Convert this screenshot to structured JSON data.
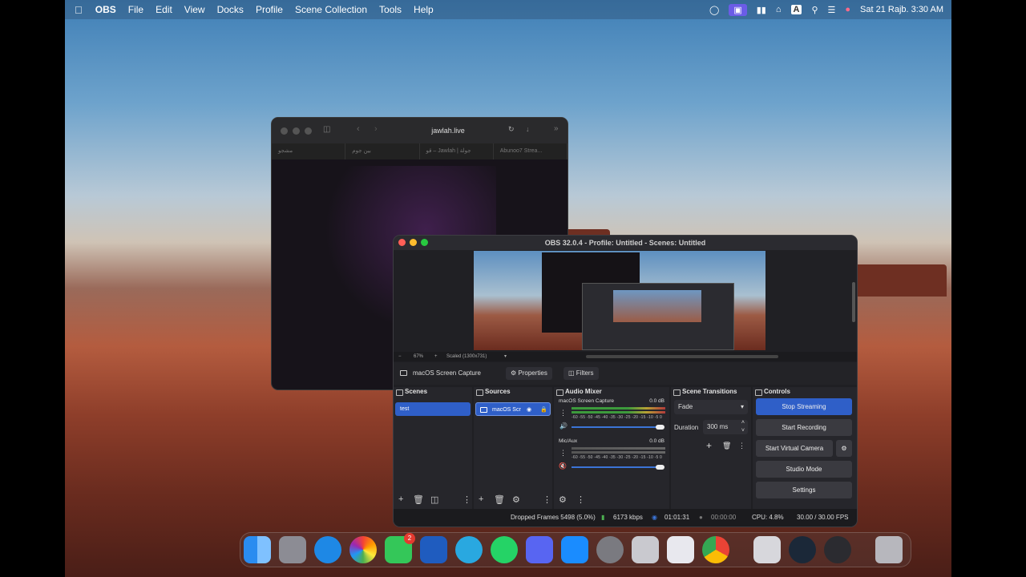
{
  "menubar": {
    "app_name": "OBS",
    "menus": [
      "File",
      "Edit",
      "View",
      "Docks",
      "Profile",
      "Scene Collection",
      "Tools",
      "Help"
    ],
    "input_indicator": "A",
    "datetime": "Sat 21 Rajb. 3:30 AM"
  },
  "browser": {
    "url": "jawlah.live",
    "tabs": [
      "مشجو",
      "بين جوم",
      "قو – Jawlah | جولة",
      "Abunoo7 Strea..."
    ]
  },
  "obs": {
    "title": "OBS 32.0.4 - Profile: Untitled - Scenes: Untitled",
    "zoom": "67%",
    "scale": "Scaled (1300x731)",
    "source_bar": {
      "selected_source": "macOS Screen Capture",
      "properties_label": "Properties",
      "filters_label": "Filters"
    },
    "scenes": {
      "header": "Scenes",
      "items": [
        "test"
      ]
    },
    "sources": {
      "header": "Sources",
      "items": [
        "macOS Scr"
      ]
    },
    "audio_mixer": {
      "header": "Audio Mixer",
      "channels": [
        {
          "name": "macOS Screen Capture",
          "db": "0.0 dB",
          "active": true
        },
        {
          "name": "Mic/Aux",
          "db": "0.0 dB",
          "active": false
        }
      ],
      "ticks": "-60 -55 -50 -45 -40 -35 -30 -25 -20 -15 -10 -5 0"
    },
    "transitions": {
      "header": "Scene Transitions",
      "transition": "Fade",
      "duration_label": "Duration",
      "duration_value": "300 ms"
    },
    "controls": {
      "header": "Controls",
      "stop_streaming": "Stop Streaming",
      "start_recording": "Start Recording",
      "start_virtual_camera": "Start Virtual Camera",
      "studio_mode": "Studio Mode",
      "settings": "Settings"
    },
    "status": {
      "dropped_frames": "Dropped Frames 5498 (5.0%)",
      "bitrate": "6173 kbps",
      "stream_time": "01:01:31",
      "record_time": "00:00:00",
      "cpu": "CPU: 4.8%",
      "fps": "30.00 / 30.00 FPS"
    }
  },
  "dock": {
    "apps": [
      "Finder",
      "Launchpad",
      "Safari",
      "Photos",
      "FaceTime",
      "Word",
      "Telegram",
      "WhatsApp",
      "Discord",
      "App Store",
      "System Settings",
      "iPhone Mirroring",
      "Parallels",
      "Chrome",
      "Automator",
      "Steam",
      "OBS",
      "Trash"
    ],
    "facetime_badge": "2"
  }
}
